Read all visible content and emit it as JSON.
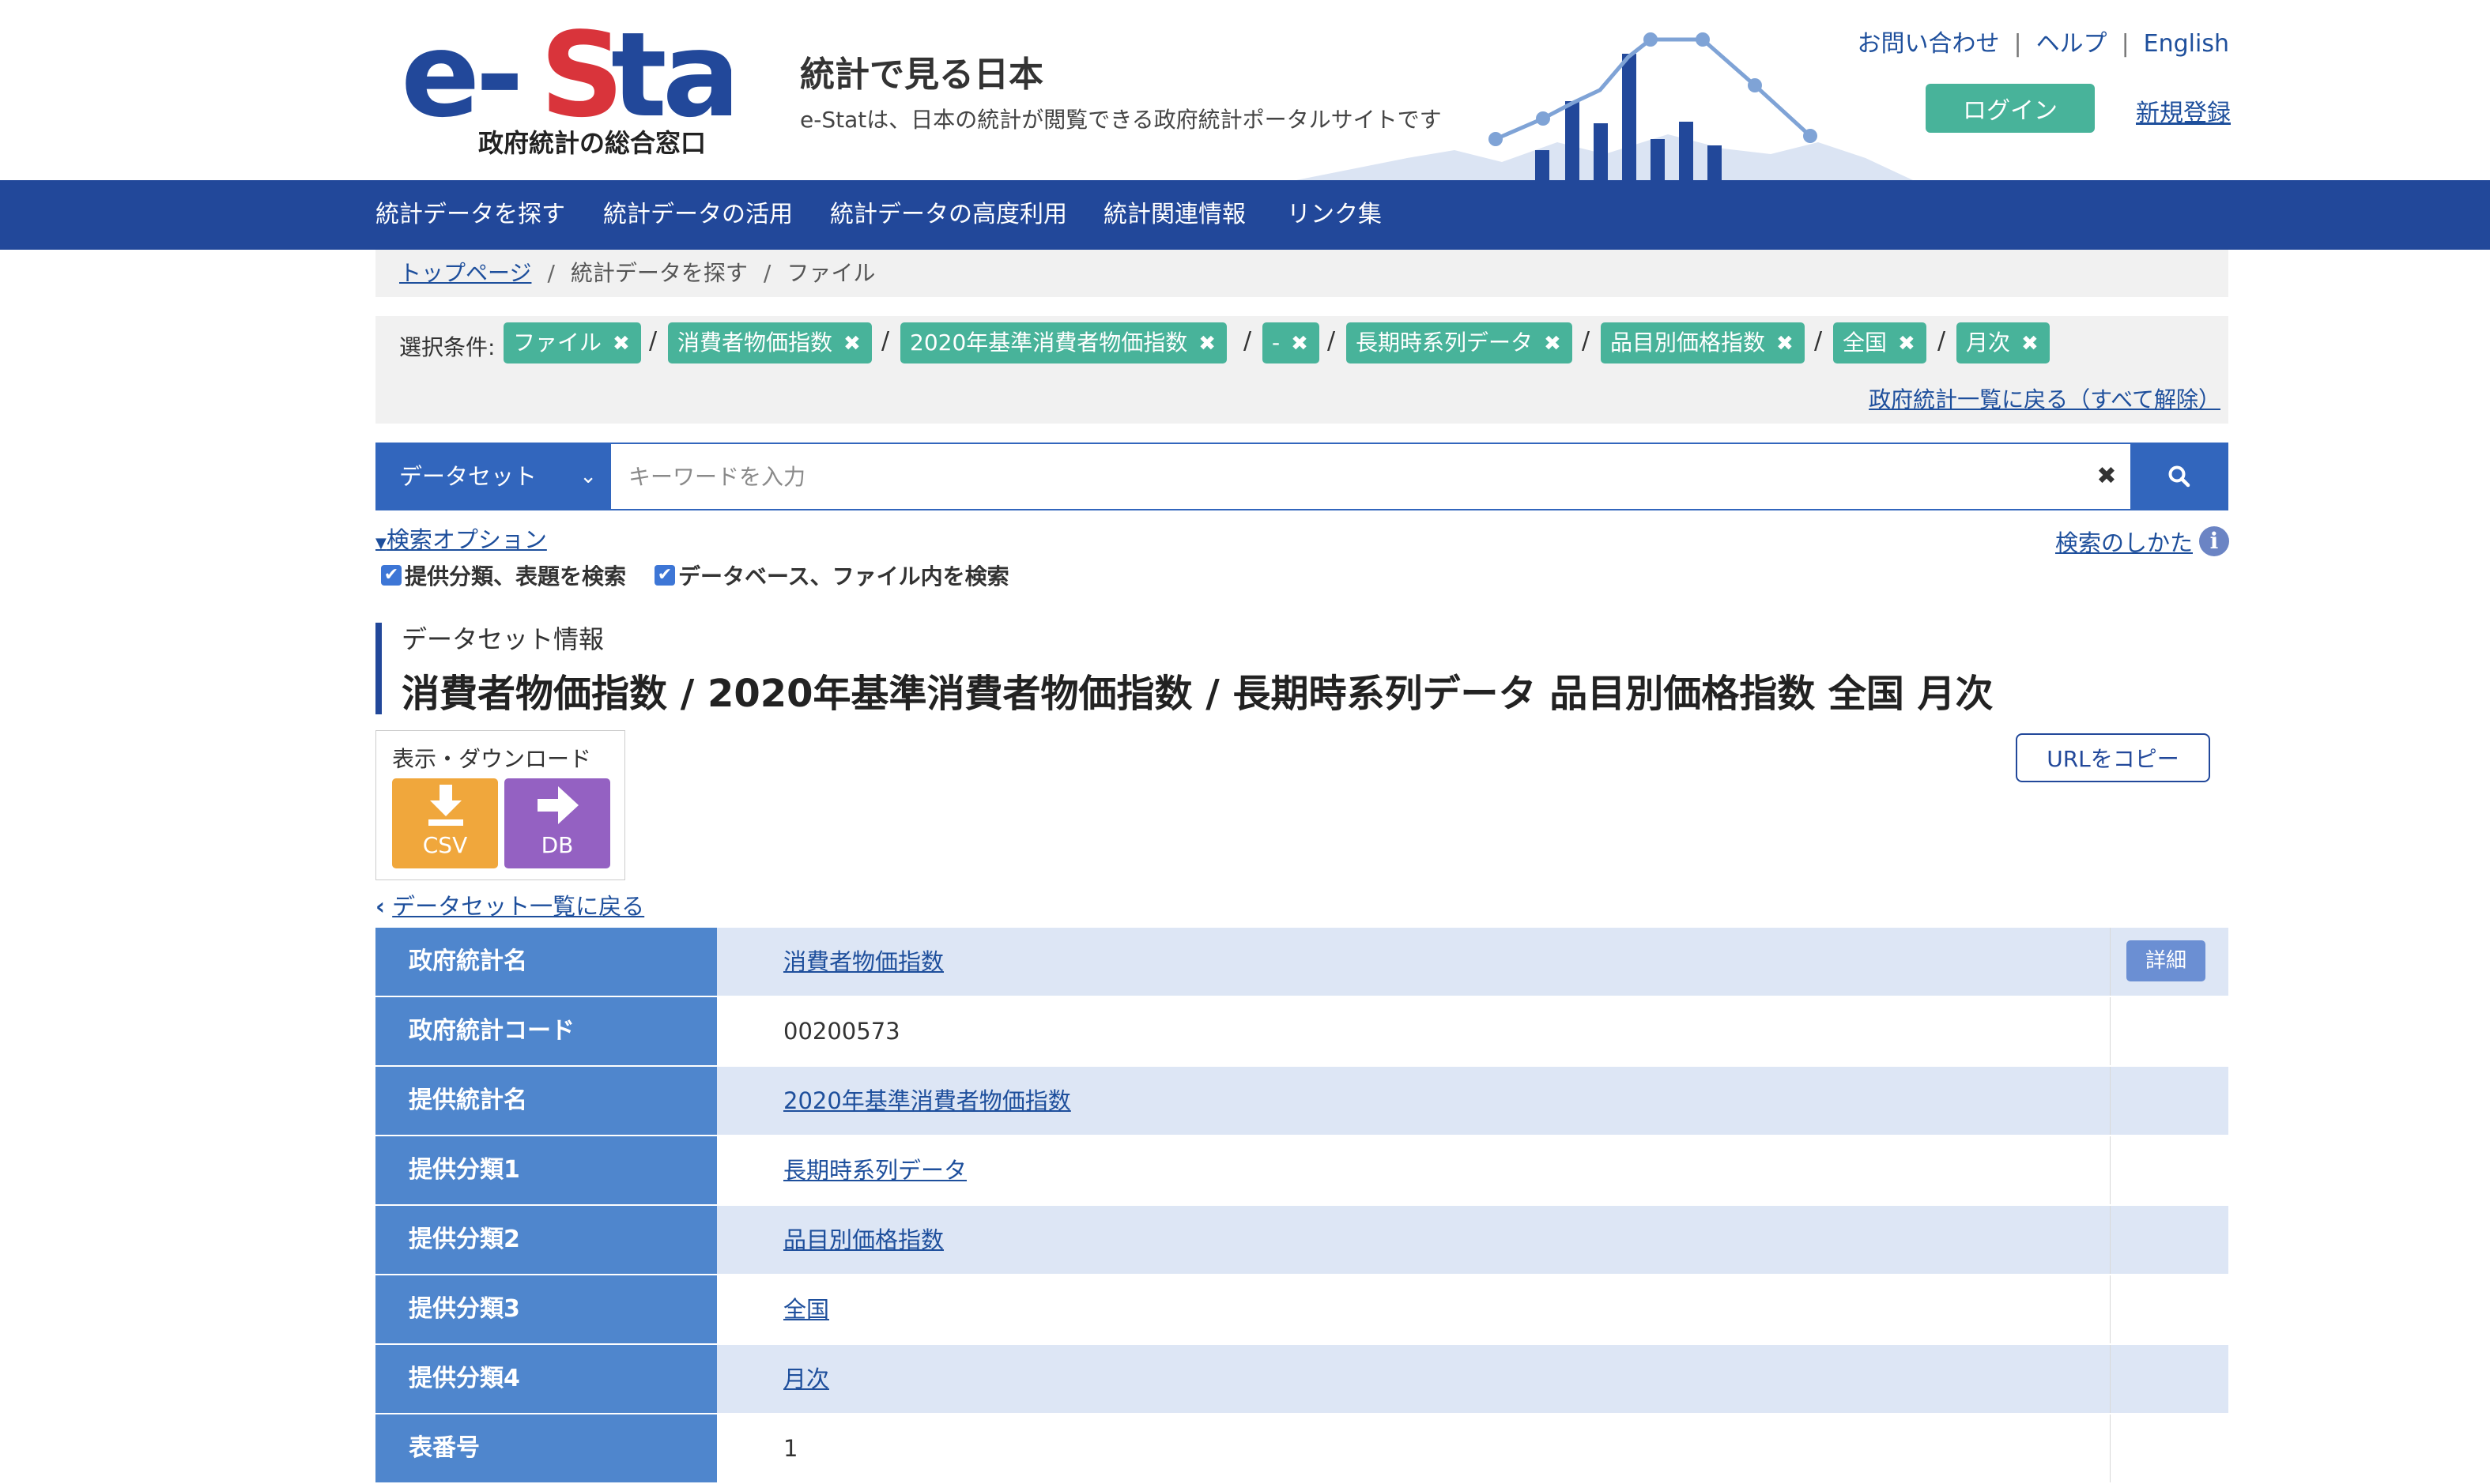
{
  "header": {
    "logo_text": "e-Stat",
    "logo_sub": "政府統計の総合窓口",
    "title": "統計で見る日本",
    "subtitle": "e-Statは、日本の統計が閲覧できる政府統計ポータルサイトです",
    "top_links": [
      "お問い合わせ",
      "ヘルプ",
      "English"
    ],
    "login": "ログイン",
    "register": "新規登録"
  },
  "nav": [
    "統計データを探す",
    "統計データの活用",
    "統計データの高度利用",
    "統計関連情報",
    "リンク集"
  ],
  "breadcrumb": [
    "トップページ",
    "統計データを探す",
    "ファイル"
  ],
  "conditions": {
    "label": "選択条件:",
    "chips": [
      "ファイル",
      "消費者物価指数",
      "2020年基準消費者物価指数",
      "-",
      "長期時系列データ",
      "品目別価格指数",
      "全国",
      "月次"
    ],
    "back_all": "政府統計一覧に戻る（すべて解除）"
  },
  "search": {
    "type": "データセット",
    "placeholder": "キーワードを入力",
    "options": "検索オプション",
    "howto": "検索のしかた",
    "check1": "提供分類、表題を検索",
    "check2": "データベース、ファイル内を検索"
  },
  "dataset": {
    "label": "データセット情報",
    "title": "消費者物価指数 / 2020年基準消費者物価指数 / 長期時系列データ 品目別価格指数 全国 月次",
    "download_label": "表示・ダウンロード",
    "csv": "CSV",
    "db": "DB",
    "copy_url": "URLをコピー",
    "back_list": "データセット一覧に戻る"
  },
  "table": {
    "detail": "詳細",
    "rows": [
      {
        "label": "政府統計名",
        "value": "消費者物価指数",
        "link": true
      },
      {
        "label": "政府統計コード",
        "value": "00200573",
        "link": false
      },
      {
        "label": "提供統計名",
        "value": "2020年基準消費者物価指数",
        "link": true
      },
      {
        "label": "提供分類1",
        "value": "長期時系列データ",
        "link": true
      },
      {
        "label": "提供分類2",
        "value": "品目別価格指数",
        "link": true
      },
      {
        "label": "提供分類3",
        "value": "全国",
        "link": true
      },
      {
        "label": "提供分類4",
        "value": "月次",
        "link": true
      },
      {
        "label": "表番号",
        "value": "1",
        "link": false
      }
    ]
  },
  "colors": {
    "brand_navy": "#22489a",
    "brand_red": "#d9343b",
    "teal": "#48b39a",
    "table_header": "#4f86cd",
    "csv": "#f0a73c",
    "db": "#9461c2"
  }
}
